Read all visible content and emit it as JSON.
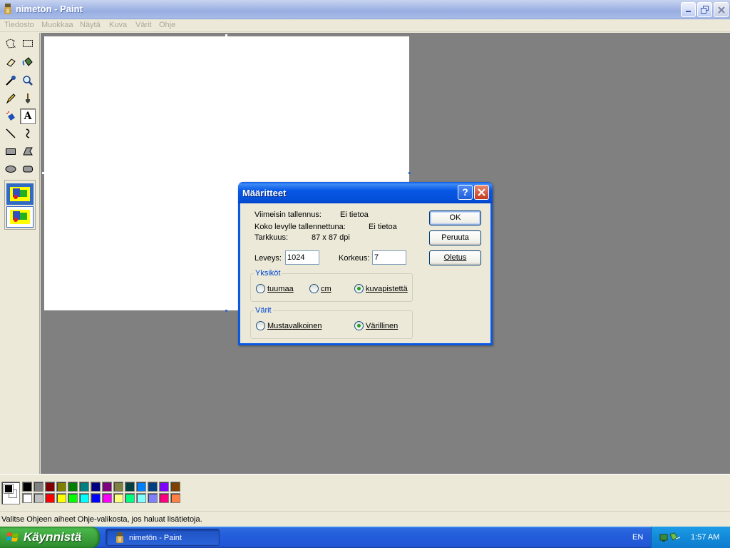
{
  "window": {
    "title": "nimetön - Paint"
  },
  "menu": {
    "items": [
      "Tiedosto",
      "Muokkaa",
      "Näytä",
      "Kuva",
      "Värit",
      "Ohje"
    ]
  },
  "tools": [
    {
      "name": "free-form-select-icon"
    },
    {
      "name": "select-icon"
    },
    {
      "name": "eraser-icon"
    },
    {
      "name": "fill-icon"
    },
    {
      "name": "pick-color-icon"
    },
    {
      "name": "magnifier-icon"
    },
    {
      "name": "pencil-icon"
    },
    {
      "name": "brush-icon"
    },
    {
      "name": "airbrush-icon"
    },
    {
      "name": "text-icon",
      "label": "A",
      "active": true
    },
    {
      "name": "line-icon"
    },
    {
      "name": "curve-icon"
    },
    {
      "name": "rectangle-icon"
    },
    {
      "name": "polygon-icon"
    },
    {
      "name": "ellipse-icon"
    },
    {
      "name": "rounded-rectangle-icon"
    }
  ],
  "palette": {
    "foreground": "#000000",
    "background": "#ffffff",
    "row1": [
      "#000000",
      "#808080",
      "#800000",
      "#808000",
      "#008000",
      "#008080",
      "#000080",
      "#800080",
      "#808040",
      "#004040",
      "#0080ff",
      "#004080",
      "#8000ff",
      "#804000"
    ],
    "row2": [
      "#ffffff",
      "#c0c0c0",
      "#ff0000",
      "#ffff00",
      "#00ff00",
      "#00ffff",
      "#0000ff",
      "#ff00ff",
      "#ffff80",
      "#00ff80",
      "#80ffff",
      "#8080ff",
      "#ff0080",
      "#ff8040"
    ]
  },
  "status": {
    "text": "Valitse Ohjeen aiheet Ohje-valikosta, jos haluat lisätietoja."
  },
  "dialog": {
    "title": "Määritteet",
    "help": "?",
    "last_saved_label": "Viimeisin tallennus:",
    "last_saved_value": "Ei tietoa",
    "size_on_disk_label": "Koko levylle tallennettuna:",
    "size_on_disk_value": "Ei tietoa",
    "resolution_label": "Tarkkuus:",
    "resolution_value": "87 x 87 dpi",
    "width_label": "Leveys:",
    "width_value": "1024",
    "height_label": "Korkeus:",
    "height_value": "7",
    "units_legend": "Yksiköt",
    "units": [
      {
        "label": "tuumaa",
        "selected": false
      },
      {
        "label": "cm",
        "selected": false
      },
      {
        "label": "kuvapistettä",
        "selected": true
      }
    ],
    "colors_legend": "Värit",
    "colors": [
      {
        "label": "Mustavalkoinen",
        "selected": false
      },
      {
        "label": "Värillinen",
        "selected": true
      }
    ],
    "ok": "OK",
    "cancel": "Peruuta",
    "default": "Oletus"
  },
  "taskbar": {
    "start": "Käynnistä",
    "task": "nimetön - Paint",
    "lang": "EN",
    "clock": "1:57 AM"
  }
}
